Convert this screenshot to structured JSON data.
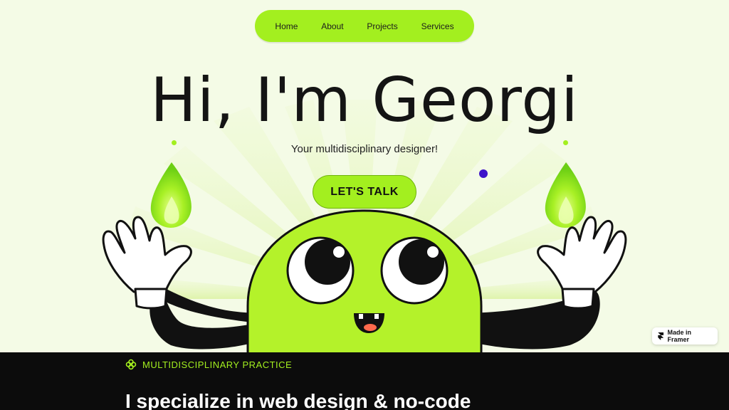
{
  "nav": {
    "items": [
      {
        "label": "Home"
      },
      {
        "label": "About"
      },
      {
        "label": "Projects"
      },
      {
        "label": "Services"
      }
    ]
  },
  "hero": {
    "title": "Hi, I'm Georgi",
    "subtitle": "Your multidisciplinary designer!",
    "cta_label": "LET'S TALK"
  },
  "badge": {
    "label": "Made in Framer",
    "icon": "framer-icon"
  },
  "section": {
    "eyebrow": "MULTIDISCIPLINARY PRACTICE",
    "eyebrow_icon": "flower-icon",
    "headline": "I specialize in web design & no-code"
  },
  "colors": {
    "accent": "#a3ef1f",
    "background": "#f4fbe6",
    "dark": "#0c0c0c",
    "dot": "#3d13c9"
  }
}
